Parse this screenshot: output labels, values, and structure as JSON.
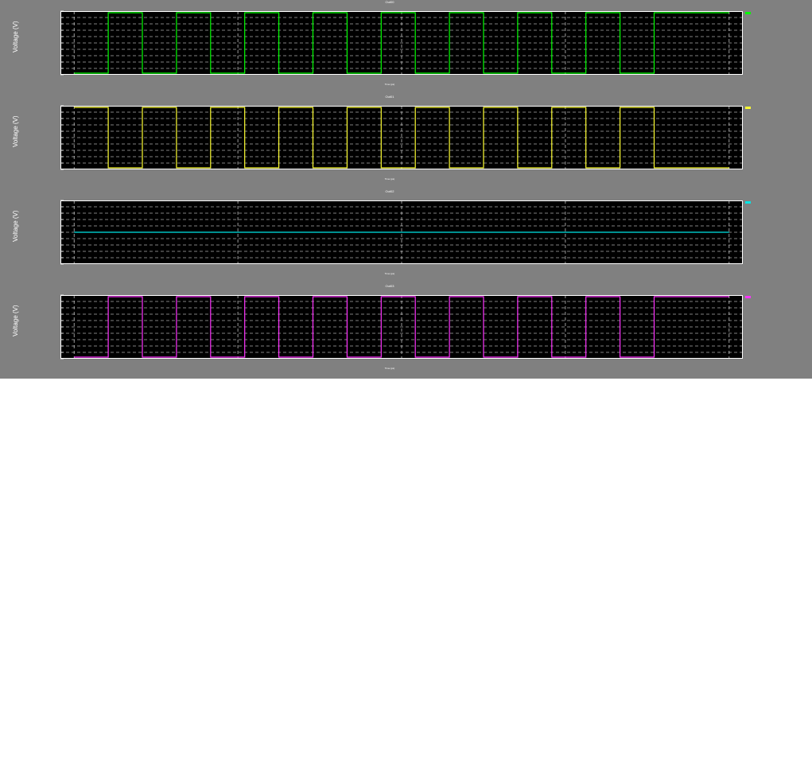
{
  "window": {
    "background": "#808080"
  },
  "chart_data": [
    {
      "type": "line",
      "title": "Out00",
      "ylabel": "Voltage (V)",
      "xlabel": "Time (ps)",
      "color": "#00ff00",
      "grid": true,
      "ylim": [
        0,
        1
      ],
      "xlim": [
        0,
        1
      ],
      "series": [
        {
          "x": [
            0.02,
            0.07,
            0.07,
            0.12,
            0.12,
            0.17,
            0.17,
            0.22,
            0.22,
            0.27,
            0.27,
            0.32,
            0.32,
            0.37,
            0.37,
            0.42,
            0.42,
            0.47,
            0.47,
            0.52,
            0.52,
            0.57,
            0.57,
            0.62,
            0.62,
            0.67,
            0.67,
            0.72,
            0.72,
            0.77,
            0.77,
            0.82,
            0.82,
            0.87,
            0.87,
            0.92,
            0.92,
            0.98
          ],
          "y": [
            0,
            0,
            1,
            1,
            0,
            0,
            1,
            1,
            0,
            0,
            1,
            1,
            0,
            0,
            1,
            1,
            0,
            0,
            1,
            1,
            0,
            0,
            1,
            1,
            0,
            0,
            1,
            1,
            0,
            0,
            1,
            1,
            0,
            0,
            1,
            1,
            1,
            1
          ]
        }
      ]
    },
    {
      "type": "line",
      "title": "Out01",
      "ylabel": "Voltage (V)",
      "xlabel": "Time (ps)",
      "color": "#ffff33",
      "grid": true,
      "ylim": [
        0,
        1
      ],
      "xlim": [
        0,
        1
      ],
      "series": [
        {
          "x": [
            0.02,
            0.07,
            0.07,
            0.12,
            0.12,
            0.17,
            0.17,
            0.22,
            0.22,
            0.27,
            0.27,
            0.32,
            0.32,
            0.37,
            0.37,
            0.42,
            0.42,
            0.47,
            0.47,
            0.52,
            0.52,
            0.57,
            0.57,
            0.62,
            0.62,
            0.67,
            0.67,
            0.72,
            0.72,
            0.77,
            0.77,
            0.82,
            0.82,
            0.87,
            0.87,
            0.92,
            0.92,
            0.98
          ],
          "y": [
            1,
            1,
            0,
            0,
            1,
            1,
            0,
            0,
            1,
            1,
            0,
            0,
            1,
            1,
            0,
            0,
            1,
            1,
            0,
            0,
            1,
            1,
            0,
            0,
            1,
            1,
            0,
            0,
            1,
            1,
            0,
            0,
            1,
            1,
            0,
            0,
            0,
            0
          ]
        }
      ]
    },
    {
      "type": "line",
      "title": "Out02",
      "ylabel": "Voltage (V)",
      "xlabel": "Time (ps)",
      "color": "#00e5e5",
      "grid": true,
      "ylim": [
        0,
        1
      ],
      "xlim": [
        0,
        1
      ],
      "series": [
        {
          "x": [
            0.02,
            0.98
          ],
          "y": [
            0.5,
            0.5
          ]
        }
      ]
    },
    {
      "type": "line",
      "title": "Out03",
      "ylabel": "Voltage (V)",
      "xlabel": "Time (ps)",
      "color": "#ff33ff",
      "grid": true,
      "ylim": [
        0,
        1
      ],
      "xlim": [
        0,
        1
      ],
      "series": [
        {
          "x": [
            0.02,
            0.07,
            0.07,
            0.12,
            0.12,
            0.17,
            0.17,
            0.22,
            0.22,
            0.27,
            0.27,
            0.32,
            0.32,
            0.37,
            0.37,
            0.42,
            0.42,
            0.47,
            0.47,
            0.52,
            0.52,
            0.57,
            0.57,
            0.62,
            0.62,
            0.67,
            0.67,
            0.72,
            0.72,
            0.77,
            0.77,
            0.82,
            0.82,
            0.87,
            0.87,
            0.92,
            0.92,
            0.98
          ],
          "y": [
            0,
            0,
            1,
            1,
            0,
            0,
            1,
            1,
            0,
            0,
            1,
            1,
            0,
            0,
            1,
            1,
            0,
            0,
            1,
            1,
            0,
            0,
            1,
            1,
            0,
            0,
            1,
            1,
            0,
            0,
            1,
            1,
            0,
            0,
            1,
            1,
            1,
            1
          ]
        }
      ]
    }
  ]
}
